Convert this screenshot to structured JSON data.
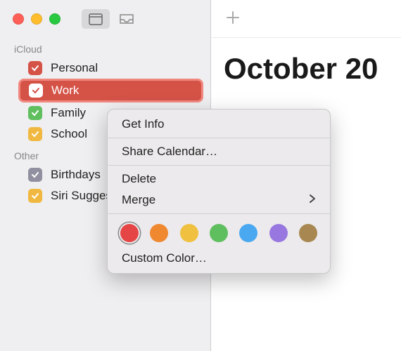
{
  "sidebar": {
    "sections": [
      {
        "title": "iCloud",
        "items": [
          {
            "label": "Personal",
            "color": "#d55247",
            "selected": false
          },
          {
            "label": "Work",
            "color": "#d55247",
            "selected": true
          },
          {
            "label": "Family",
            "color": "#5fbf5f",
            "selected": false
          },
          {
            "label": "School",
            "color": "#f0b840",
            "selected": false
          }
        ]
      },
      {
        "title": "Other",
        "items": [
          {
            "label": "Birthdays",
            "color": "#9090a0",
            "selected": false
          },
          {
            "label": "Siri Suggestions",
            "color": "#f0b840",
            "selected": false
          }
        ]
      }
    ]
  },
  "main": {
    "month_title": "October 20"
  },
  "context_menu": {
    "get_info": "Get Info",
    "share": "Share Calendar…",
    "delete": "Delete",
    "merge": "Merge",
    "custom_color": "Custom Color…",
    "colors": [
      {
        "name": "red",
        "hex": "#e64545",
        "selected": true
      },
      {
        "name": "orange",
        "hex": "#f08830",
        "selected": false
      },
      {
        "name": "yellow",
        "hex": "#f0c040",
        "selected": false
      },
      {
        "name": "green",
        "hex": "#5fbf5f",
        "selected": false
      },
      {
        "name": "blue",
        "hex": "#4aa8f0",
        "selected": false
      },
      {
        "name": "purple",
        "hex": "#9878e0",
        "selected": false
      },
      {
        "name": "brown",
        "hex": "#a88850",
        "selected": false
      }
    ]
  }
}
